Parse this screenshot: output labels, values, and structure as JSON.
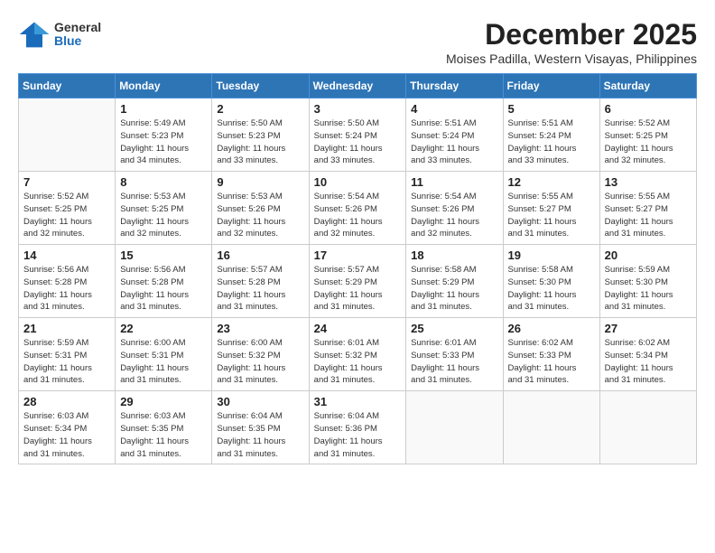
{
  "header": {
    "logo_general": "General",
    "logo_blue": "Blue",
    "month_year": "December 2025",
    "location": "Moises Padilla, Western Visayas, Philippines"
  },
  "weekdays": [
    "Sunday",
    "Monday",
    "Tuesday",
    "Wednesday",
    "Thursday",
    "Friday",
    "Saturday"
  ],
  "weeks": [
    [
      {
        "day": "",
        "info": ""
      },
      {
        "day": "1",
        "info": "Sunrise: 5:49 AM\nSunset: 5:23 PM\nDaylight: 11 hours\nand 34 minutes."
      },
      {
        "day": "2",
        "info": "Sunrise: 5:50 AM\nSunset: 5:23 PM\nDaylight: 11 hours\nand 33 minutes."
      },
      {
        "day": "3",
        "info": "Sunrise: 5:50 AM\nSunset: 5:24 PM\nDaylight: 11 hours\nand 33 minutes."
      },
      {
        "day": "4",
        "info": "Sunrise: 5:51 AM\nSunset: 5:24 PM\nDaylight: 11 hours\nand 33 minutes."
      },
      {
        "day": "5",
        "info": "Sunrise: 5:51 AM\nSunset: 5:24 PM\nDaylight: 11 hours\nand 33 minutes."
      },
      {
        "day": "6",
        "info": "Sunrise: 5:52 AM\nSunset: 5:25 PM\nDaylight: 11 hours\nand 32 minutes."
      }
    ],
    [
      {
        "day": "7",
        "info": "Sunrise: 5:52 AM\nSunset: 5:25 PM\nDaylight: 11 hours\nand 32 minutes."
      },
      {
        "day": "8",
        "info": "Sunrise: 5:53 AM\nSunset: 5:25 PM\nDaylight: 11 hours\nand 32 minutes."
      },
      {
        "day": "9",
        "info": "Sunrise: 5:53 AM\nSunset: 5:26 PM\nDaylight: 11 hours\nand 32 minutes."
      },
      {
        "day": "10",
        "info": "Sunrise: 5:54 AM\nSunset: 5:26 PM\nDaylight: 11 hours\nand 32 minutes."
      },
      {
        "day": "11",
        "info": "Sunrise: 5:54 AM\nSunset: 5:26 PM\nDaylight: 11 hours\nand 32 minutes."
      },
      {
        "day": "12",
        "info": "Sunrise: 5:55 AM\nSunset: 5:27 PM\nDaylight: 11 hours\nand 31 minutes."
      },
      {
        "day": "13",
        "info": "Sunrise: 5:55 AM\nSunset: 5:27 PM\nDaylight: 11 hours\nand 31 minutes."
      }
    ],
    [
      {
        "day": "14",
        "info": "Sunrise: 5:56 AM\nSunset: 5:28 PM\nDaylight: 11 hours\nand 31 minutes."
      },
      {
        "day": "15",
        "info": "Sunrise: 5:56 AM\nSunset: 5:28 PM\nDaylight: 11 hours\nand 31 minutes."
      },
      {
        "day": "16",
        "info": "Sunrise: 5:57 AM\nSunset: 5:28 PM\nDaylight: 11 hours\nand 31 minutes."
      },
      {
        "day": "17",
        "info": "Sunrise: 5:57 AM\nSunset: 5:29 PM\nDaylight: 11 hours\nand 31 minutes."
      },
      {
        "day": "18",
        "info": "Sunrise: 5:58 AM\nSunset: 5:29 PM\nDaylight: 11 hours\nand 31 minutes."
      },
      {
        "day": "19",
        "info": "Sunrise: 5:58 AM\nSunset: 5:30 PM\nDaylight: 11 hours\nand 31 minutes."
      },
      {
        "day": "20",
        "info": "Sunrise: 5:59 AM\nSunset: 5:30 PM\nDaylight: 11 hours\nand 31 minutes."
      }
    ],
    [
      {
        "day": "21",
        "info": "Sunrise: 5:59 AM\nSunset: 5:31 PM\nDaylight: 11 hours\nand 31 minutes."
      },
      {
        "day": "22",
        "info": "Sunrise: 6:00 AM\nSunset: 5:31 PM\nDaylight: 11 hours\nand 31 minutes."
      },
      {
        "day": "23",
        "info": "Sunrise: 6:00 AM\nSunset: 5:32 PM\nDaylight: 11 hours\nand 31 minutes."
      },
      {
        "day": "24",
        "info": "Sunrise: 6:01 AM\nSunset: 5:32 PM\nDaylight: 11 hours\nand 31 minutes."
      },
      {
        "day": "25",
        "info": "Sunrise: 6:01 AM\nSunset: 5:33 PM\nDaylight: 11 hours\nand 31 minutes."
      },
      {
        "day": "26",
        "info": "Sunrise: 6:02 AM\nSunset: 5:33 PM\nDaylight: 11 hours\nand 31 minutes."
      },
      {
        "day": "27",
        "info": "Sunrise: 6:02 AM\nSunset: 5:34 PM\nDaylight: 11 hours\nand 31 minutes."
      }
    ],
    [
      {
        "day": "28",
        "info": "Sunrise: 6:03 AM\nSunset: 5:34 PM\nDaylight: 11 hours\nand 31 minutes."
      },
      {
        "day": "29",
        "info": "Sunrise: 6:03 AM\nSunset: 5:35 PM\nDaylight: 11 hours\nand 31 minutes."
      },
      {
        "day": "30",
        "info": "Sunrise: 6:04 AM\nSunset: 5:35 PM\nDaylight: 11 hours\nand 31 minutes."
      },
      {
        "day": "31",
        "info": "Sunrise: 6:04 AM\nSunset: 5:36 PM\nDaylight: 11 hours\nand 31 minutes."
      },
      {
        "day": "",
        "info": ""
      },
      {
        "day": "",
        "info": ""
      },
      {
        "day": "",
        "info": ""
      }
    ]
  ]
}
